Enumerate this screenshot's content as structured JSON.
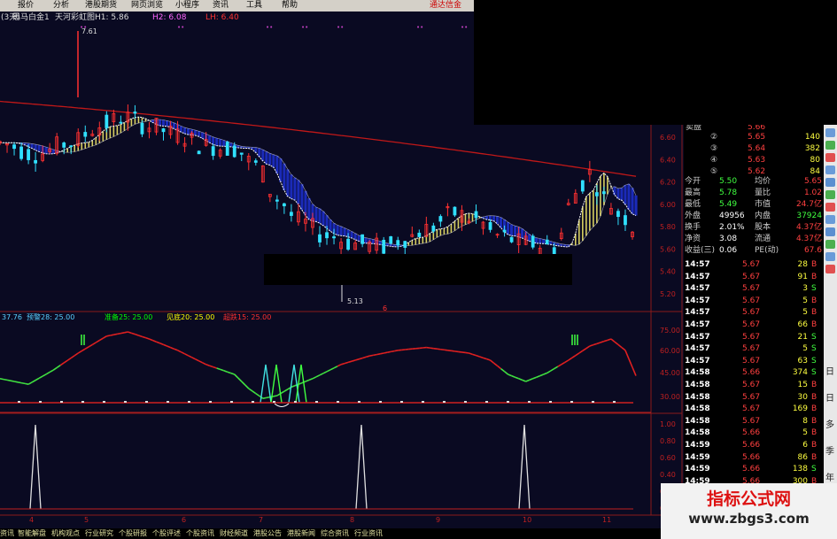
{
  "menu": [
    "报价",
    "分析",
    "港股期货",
    "网页浏览",
    "小程序",
    "资讯",
    "工具",
    "帮助"
  ],
  "brand": "通达信金",
  "title_bar": {
    "prefix": "(3天)",
    "stock": "黑马白金1",
    "h1": "天河彩虹图H1: 5.86",
    "h2": "H2: 6.08",
    "lh": "LH: 6.40"
  },
  "main_chart": {
    "price_ticks": [
      "6.60",
      "6.40",
      "6.20",
      "6.00",
      "5.80",
      "5.60",
      "5.40",
      "5.20"
    ],
    "high_label": "7.61",
    "low_label": "5.13",
    "marker": "6"
  },
  "indicator_bar": {
    "v1": "37.76",
    "v2": "预警28: 25.00",
    "v3": "准备25: 25.00",
    "v4": "见底20: 25.00",
    "v5": "超跌15: 25.00"
  },
  "osc_ticks": [
    "75.00",
    "60.00",
    "45.00",
    "30.00"
  ],
  "pulse_ticks": [
    "1.00",
    "0.80",
    "0.60",
    "0.40",
    "0.20",
    "0.00"
  ],
  "x_ticks": [
    "4",
    "5",
    "6",
    "7",
    "8",
    "9",
    "10",
    "11"
  ],
  "quote": {
    "asks_partial": {
      "label": "卖盘",
      "price": "5.66"
    },
    "asks": [
      {
        "level": "②",
        "price": "5.65",
        "vol": "140"
      },
      {
        "level": "③",
        "price": "5.64",
        "vol": "382"
      },
      {
        "level": "④",
        "price": "5.63",
        "vol": "80"
      },
      {
        "level": "⑤",
        "price": "5.62",
        "vol": "84"
      }
    ],
    "stats": [
      {
        "k1": "今开",
        "v1": "5.50",
        "k2": "均价",
        "v2": "5.65"
      },
      {
        "k1": "最高",
        "v1": "5.78",
        "k2": "量比",
        "v2": "1.02"
      },
      {
        "k1": "最低",
        "v1": "5.49",
        "k2": "市值",
        "v2": "24.7亿"
      },
      {
        "k1": "外盘",
        "v1": "49956",
        "k2": "内盘",
        "v2": "37924"
      },
      {
        "k1": "换手",
        "v1": "2.01%",
        "k2": "股本",
        "v2": "4.37亿"
      },
      {
        "k1": "净资",
        "v1": "3.08",
        "k2": "流通",
        "v2": "4.37亿"
      },
      {
        "k1": "收益(三)",
        "v1": "0.06",
        "k2": "PE(动)",
        "v2": "67.6"
      }
    ],
    "ticks": [
      {
        "t": "14:57",
        "p": "5.67",
        "v": "28",
        "s": "B"
      },
      {
        "t": "14:57",
        "p": "5.67",
        "v": "91",
        "s": "B"
      },
      {
        "t": "14:57",
        "p": "5.67",
        "v": "3",
        "s": "S"
      },
      {
        "t": "14:57",
        "p": "5.67",
        "v": "5",
        "s": "B"
      },
      {
        "t": "14:57",
        "p": "5.67",
        "v": "5",
        "s": "B"
      },
      {
        "t": "14:57",
        "p": "5.67",
        "v": "66",
        "s": "B"
      },
      {
        "t": "14:57",
        "p": "5.67",
        "v": "21",
        "s": "S"
      },
      {
        "t": "14:57",
        "p": "5.67",
        "v": "5",
        "s": "S"
      },
      {
        "t": "14:57",
        "p": "5.67",
        "v": "63",
        "s": "S"
      },
      {
        "t": "14:58",
        "p": "5.66",
        "v": "374",
        "s": "S"
      },
      {
        "t": "14:58",
        "p": "5.67",
        "v": "15",
        "s": "B"
      },
      {
        "t": "14:58",
        "p": "5.67",
        "v": "30",
        "s": "B"
      },
      {
        "t": "14:58",
        "p": "5.67",
        "v": "169",
        "s": "B"
      },
      {
        "t": "14:58",
        "p": "5.67",
        "v": "8",
        "s": "B"
      },
      {
        "t": "14:58",
        "p": "5.66",
        "v": "5",
        "s": "B"
      },
      {
        "t": "14:59",
        "p": "5.66",
        "v": "6",
        "s": "B"
      },
      {
        "t": "14:59",
        "p": "5.66",
        "v": "86",
        "s": "B"
      },
      {
        "t": "14:59",
        "p": "5.66",
        "v": "138",
        "s": "S"
      },
      {
        "t": "14:59",
        "p": "5.66",
        "v": "300",
        "s": "B"
      },
      {
        "t": "14:59",
        "p": "5.66",
        "v": "1",
        "s": "S"
      },
      {
        "t": "14:59",
        "p": "5.66",
        "v": "1",
        "s": "S"
      }
    ]
  },
  "side_tools": [
    "#6a9bd8",
    "#4caf50",
    "#e05050",
    "#6a9bd8",
    "#5b8fd0",
    "#4caf50",
    "#e05050",
    "#6a9bd8",
    "#5b8fd0",
    "#4caf50",
    "#6a9bd8",
    "#e05050"
  ],
  "side_chars": [
    "日",
    "日",
    "多",
    "季",
    "年"
  ],
  "bottom_tabs": [
    "资讯",
    "智能解盘",
    "机构观点",
    "行业研究",
    "个股研报",
    "个股评述",
    "个股资讯",
    "财经频道",
    "港股公告",
    "港股新闻",
    "综合资讯",
    "行业资讯"
  ],
  "watermark": {
    "line1": "指标公式网",
    "line2": "www.zbgs3.com"
  },
  "colors": {
    "up": "#ff3333",
    "down": "#00ffff",
    "yellow": "#ffff00",
    "green": "#00ff00",
    "bg": "#0a0a22"
  }
}
